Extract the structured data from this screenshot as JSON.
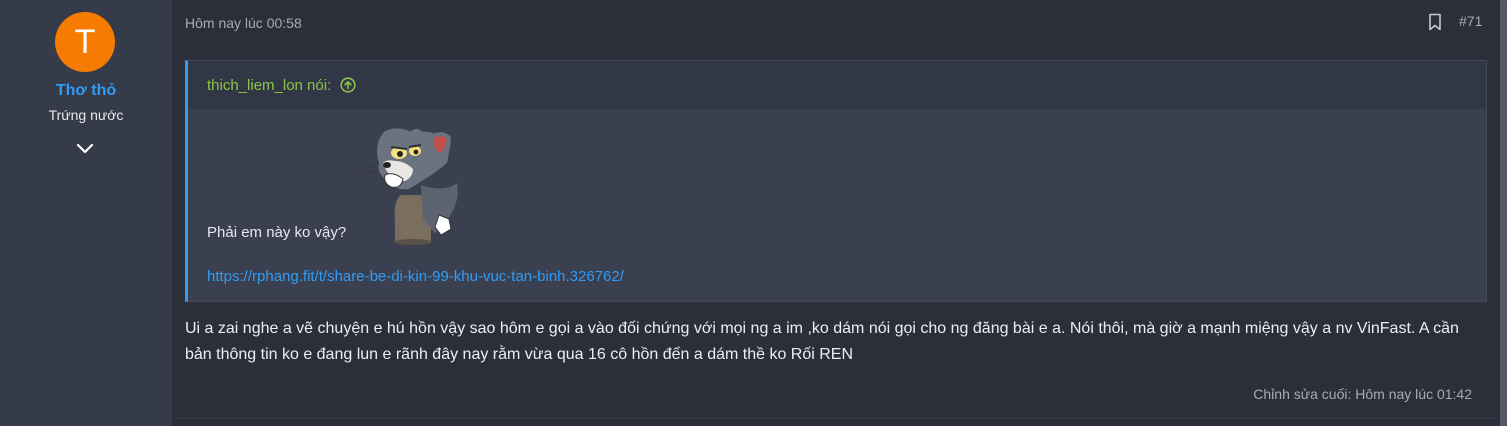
{
  "user": {
    "avatar_letter": "T",
    "avatar_color": "#f57c00",
    "name": "Thơ thỏ",
    "name_color": "#2f9cf5",
    "title": "Trứng nước",
    "expand_icon": "chevron-down-icon"
  },
  "post": {
    "timestamp": "Hôm nay lúc 00:58",
    "bookmark_icon": "bookmark-icon",
    "number": "#71",
    "quote": {
      "author": "thich_liem_lon nói:",
      "author_color": "#8bc34a",
      "jump_icon": "arrow-up-circle-icon",
      "sticker": "tom-cat-sticker",
      "text": "Phải em này ko vậy?",
      "link": "https://rphang.fit/t/share-be-di-kin-99-khu-vuc-tan-binh.326762/"
    },
    "message": "Ui a zai nghe a vẽ chuyện e hú hồn vậy sao hôm e gọi a vào đối chứng với mọi ng a im ,ko dám nói gọi cho ng đăng bài e a. Nói thôi, mà giờ a mạnh miệng vậy a nv VinFast. A cần bản thông tin ko e đang lun e rãnh đây nay rằm vừa qua 16 cô hồn đến a dám thề ko Rối REN",
    "edited": "Chỉnh sửa cuối: Hôm nay lúc 01:42"
  }
}
